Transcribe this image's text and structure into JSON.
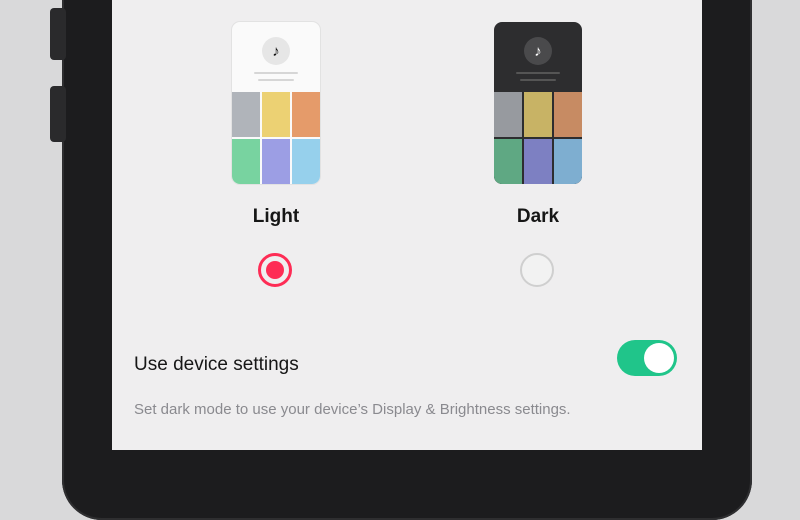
{
  "themes": {
    "light": {
      "label": "Light",
      "selected": true,
      "logo_glyph": "♪",
      "tiles": [
        "#b0b4ba",
        "#ecd173",
        "#e59b6a",
        "#78d3a0",
        "#9c9ee4",
        "#96d0ec"
      ]
    },
    "dark": {
      "label": "Dark",
      "selected": false,
      "logo_glyph": "♪",
      "tiles": [
        "#979a9f",
        "#c8b365",
        "#c78b63",
        "#5fa883",
        "#7d80c2",
        "#7eaed0"
      ]
    }
  },
  "device_settings": {
    "label": "Use device settings",
    "enabled": true,
    "description": "Set dark mode to use your device’s Display & Brightness settings."
  },
  "colors": {
    "accent": "#fe2c55",
    "toggle_on": "#20c58a"
  },
  "icons": {
    "app_logo": "tiktok-logo-icon"
  }
}
